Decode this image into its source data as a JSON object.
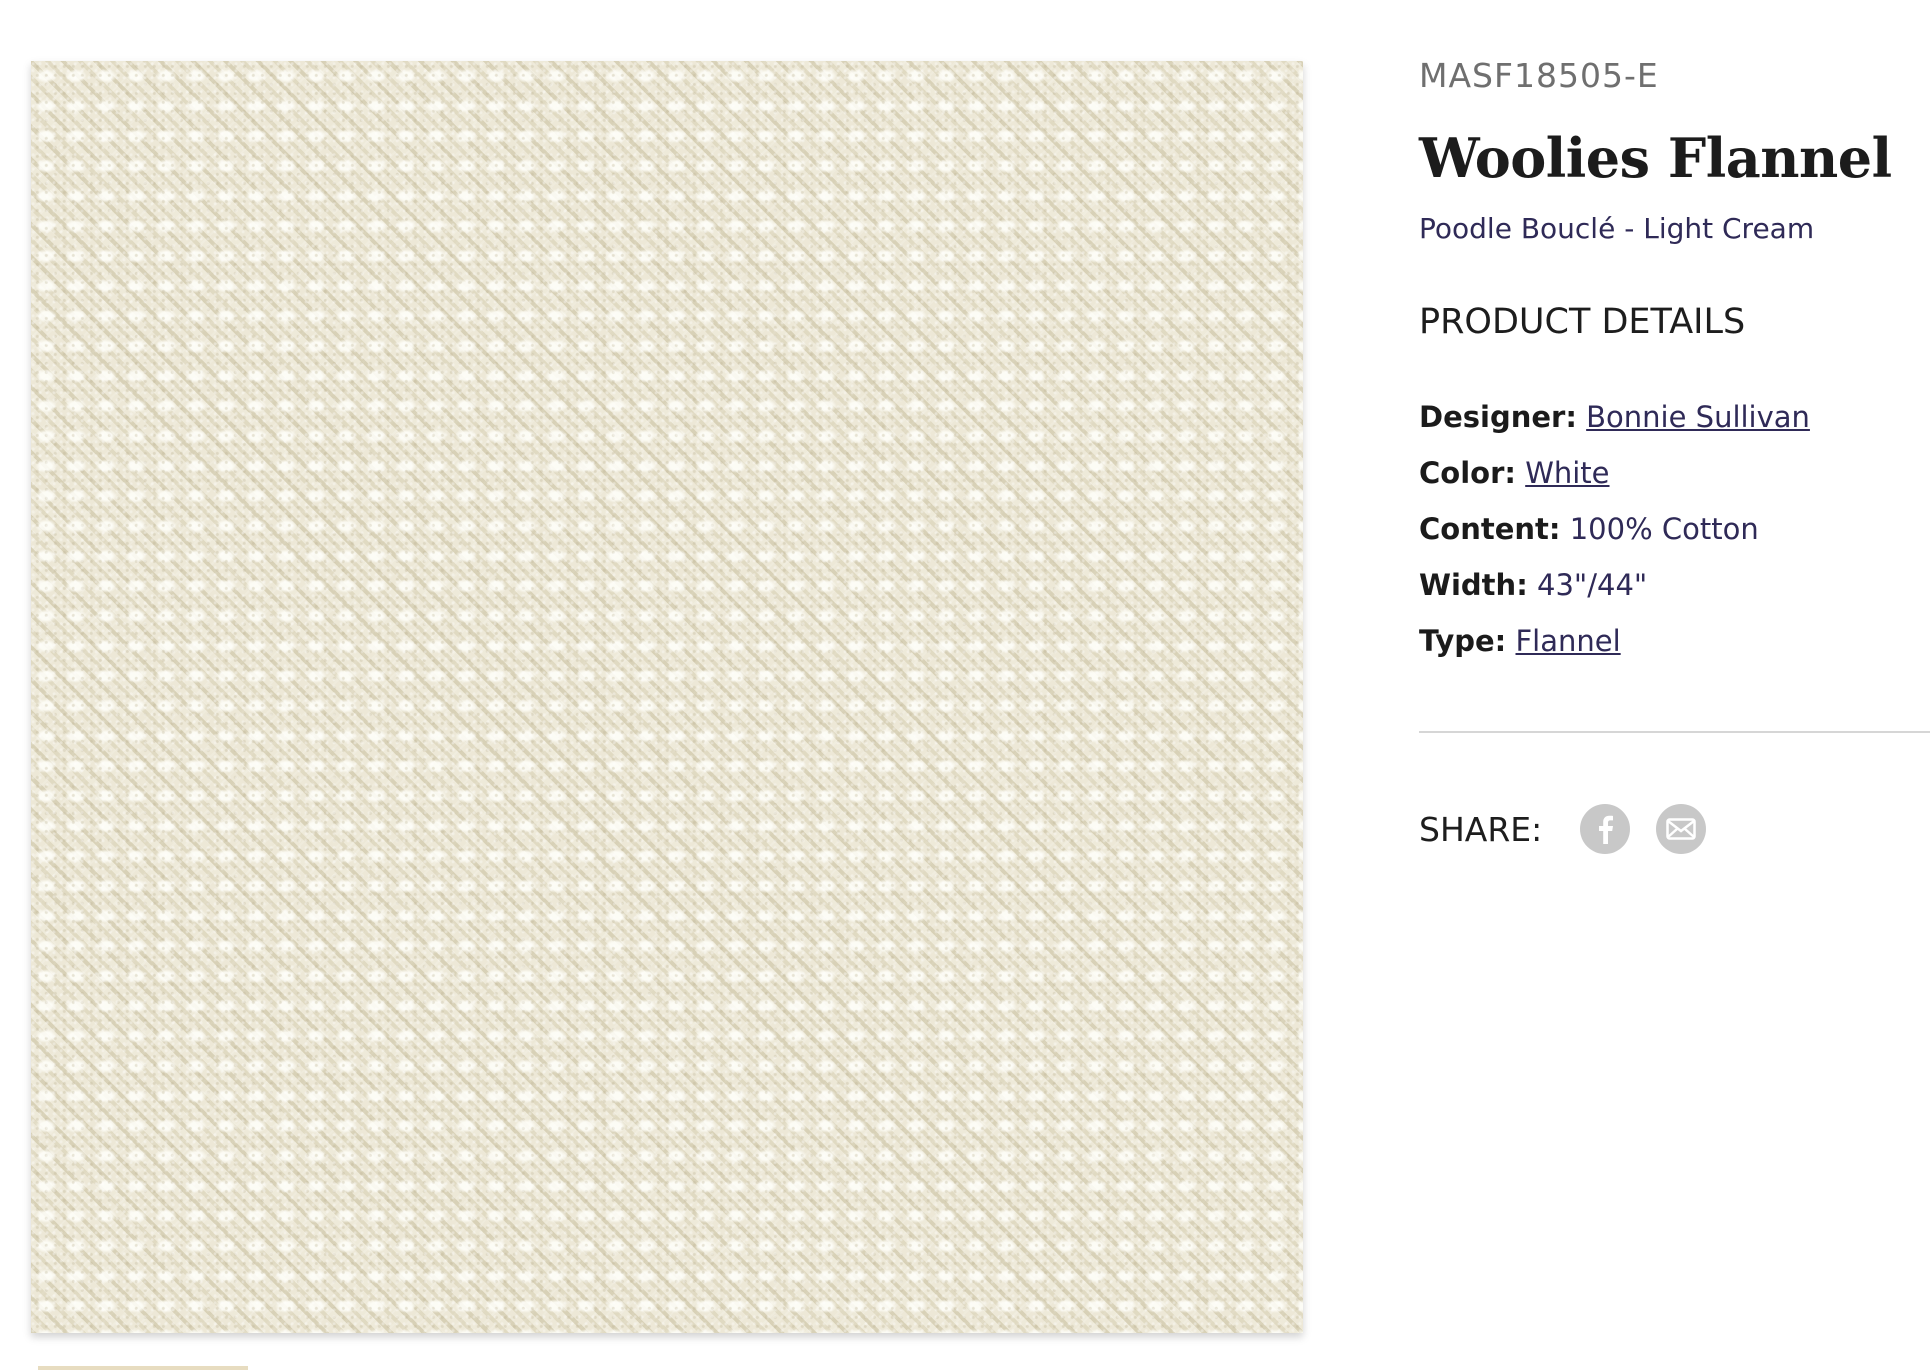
{
  "product": {
    "sku": "MASF18505-E",
    "title": "Woolies Flannel",
    "subtitle": "Poodle Bouclé - Light Cream",
    "image_alt": "Poodle Bouclé - Light Cream fabric swatch"
  },
  "details": {
    "heading": "PRODUCT DETAILS",
    "designer_label": "Designer:",
    "designer_value": "Bonnie Sullivan",
    "color_label": "Color:",
    "color_value": "White",
    "content_label": "Content:",
    "content_value": "100% Cotton",
    "width_label": "Width:",
    "width_value": "43\"/44\"",
    "type_label": "Type:",
    "type_value": "Flannel"
  },
  "share": {
    "label": "SHARE:",
    "icons": [
      "facebook-icon",
      "email-icon"
    ]
  },
  "colors": {
    "accent_text": "#2f2a57",
    "share_icon_bg": "#c8c8c8",
    "swatch_base": "#ebe6d3"
  }
}
